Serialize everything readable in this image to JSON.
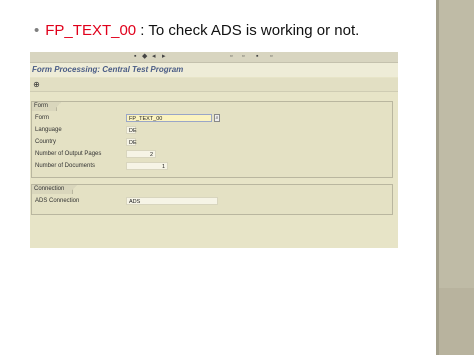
{
  "slide": {
    "bullet": "•",
    "code": "FP_TEXT_00",
    "text": " : To check ADS is working or not."
  },
  "sap": {
    "title": "Form Processing: Central Test Program",
    "form_group": {
      "title": "Form",
      "rows": [
        {
          "label": "Form",
          "value": "FP_TEXT_00"
        },
        {
          "label": "Language",
          "value": "DE"
        },
        {
          "label": "Country",
          "value": "DE"
        },
        {
          "label": "Number of Output Pages",
          "value": "2"
        },
        {
          "label": "Number of Documents",
          "value": "1"
        }
      ]
    },
    "connection_group": {
      "title": "Connection",
      "label": "ADS Connection",
      "value": "ADS"
    },
    "icons": {
      "execute": "execute-icon",
      "f4_help": "value-help-icon"
    }
  },
  "colors": {
    "code_red": "#e0001b",
    "sap_bg": "#e7e4c7",
    "title_blue": "#4a5c86",
    "side_bar": "#b8b39e"
  }
}
